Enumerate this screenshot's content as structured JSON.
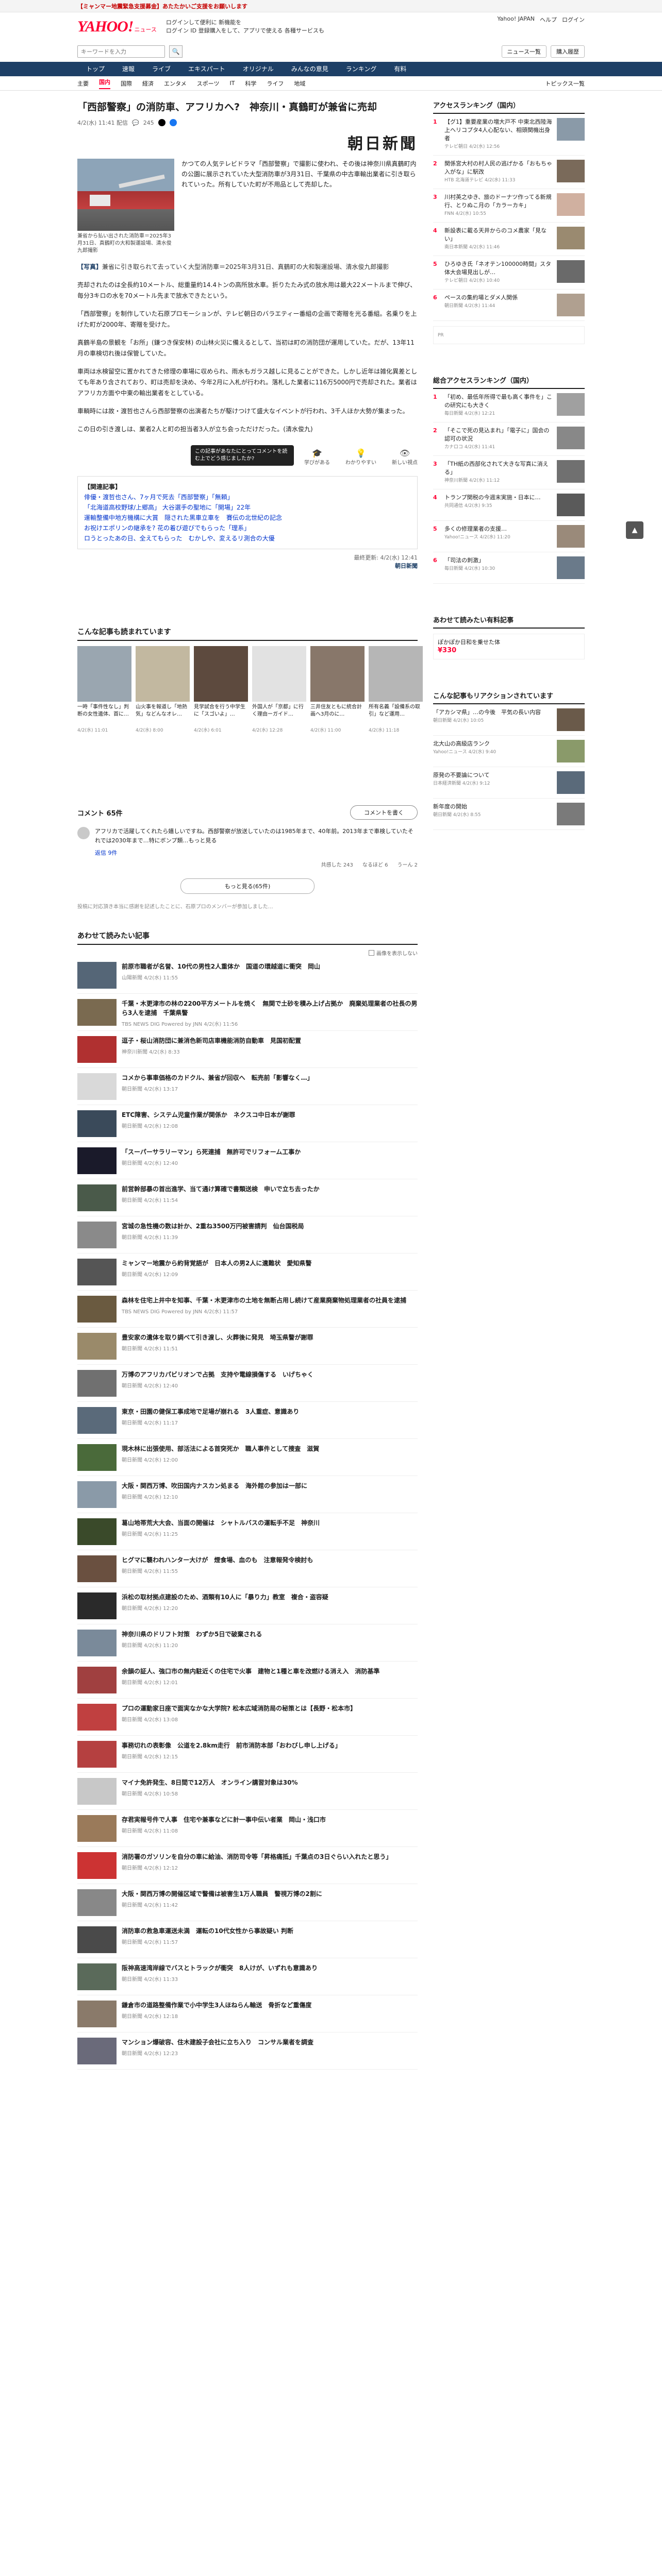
{
  "top_bar": {
    "alert": "【ミャンマー地震緊急支援募金】あたたかいご支援をお願いします"
  },
  "header": {
    "logo": "YAHOO!",
    "logo_sub": "ニュース",
    "msg_line1": "ログインして便利に 新機能を",
    "msg_line2": "ログイン ID 登録購入をして、アプリで使える 各種サービスも",
    "right_links": [
      "Yahoo! JAPAN",
      "ヘルプ",
      "ログイン"
    ]
  },
  "search": {
    "placeholder": "キーワードを入力",
    "right_links": [
      "ニュース一覧",
      "購入履歴"
    ]
  },
  "cat_nav": [
    "トップ",
    "速報",
    "ライブ",
    "エキスパート",
    "オリジナル",
    "みんなの意見",
    "ランキング",
    "有料"
  ],
  "sub_nav": [
    "主要",
    "国内",
    "国際",
    "経済",
    "エンタメ",
    "スポーツ",
    "IT",
    "科学",
    "ライフ",
    "地域"
  ],
  "sub_nav_active": 1,
  "topics_link": "トピックス一覧",
  "article": {
    "title": "「西部警察」の消防車、アフリカへ?　神奈川・真鶴町が兼省に売却",
    "datetime": "4/2(水) 11:41 配信",
    "comments_count": "245",
    "publisher": "朝日新聞",
    "photo_caption": "兼省から払い出された消防車＝2025年3月31日、真鶴町の大和製運設場、清水俊九郎撮影",
    "lead": "かつての人気テレビドラマ「西部警察」で撮影に使われ、その後は神奈川県真鶴町内の公園に展示されていた大型消防車が3月31日、千葉県の中古車輸出業者に引き取られていった。所有していた町が不用品として売却した。",
    "paragraphs": [
      "売却されたのは全長約10メートル、総重量約14.4トンの高所放水車。折りたたみ式の放水用は最大22メートルまで伸び、毎分3キロの水を70メートル先まで放水できたという。",
      "「西部警察」を制作していた石原プロモーションが、テレビ朝日のバラエティー番組の企画で寄贈を光る番組。名乗りを上げた町が2000年、寄贈を受けた。",
      "真鶴半島の景観を「お所」(鎌つき保安林) の山林火災に備えるとして、当初は町の消防団が運用していた。だが、13年11月の車検切れ後は保管していた。",
      "車両は水検留空に置かれてきた修理の車場に収められ、雨水もガラス越しに見ることができた。しかし近年は雑化異差としても年あり含されており、町は売却を決め、今年2月に入札が行われ。落札した業者に116万5000円で売却された。業者はアフリカ方面や中東の輸出業者をとしている。",
      "車輌時には故・渡哲也さんら西部警察の出演者たちが駆けつけて盛大なイベントが行われ、3千人ほか大勢が集まった。",
      "この日の引き渡しは、業者2人と町の担当者3人が立ち会っただけだった。(清水俊九)"
    ],
    "photo_note_label": "【写真】",
    "photo_note": "兼省に引き取られて去っていく大型消防車＝2025年3月31日、真鶴町の大和製運設場、清水俊九郎撮影",
    "report_link": "朝日新聞",
    "tooltip": "この記事があなたにとってコメントを読む上でどう感じましたか?",
    "reactions": [
      "学びがある",
      "わかりやすい",
      "新しい視点"
    ],
    "related_head": "【関連記事】",
    "related_links": [
      "俳優・渡哲也さん、7ヶ月で死去「西部警察」「無頼」",
      "「北海道高校野球/上郷高」 大谷選手の聖地に「開場」22年",
      "運輸整備中地方機構に大賞　隠された黒車立車を　賽伝の北世紀の記念",
      "お祝けエポリンの継承を? 花の着び遊びでもらった「理系」",
      "ロうとったあの日、全えてもらった　むかしや、変えるリ測合の大優"
    ],
    "end_meta": "最終更新: 4/2(水) 12:41",
    "end_publisher": "朝日新聞"
  },
  "recommend": {
    "title": "こんな記事も読まれています",
    "items": [
      {
        "title": "一時「事件性なし」判断の女性遺体、首に…",
        "src": "4/2(水) 11:01",
        "color": "#9aa6b0"
      },
      {
        "title": "山火事を報道し「地熱気」などんなオレ…",
        "src": "4/2(水) 8:00",
        "color": "#c2b8a0"
      },
      {
        "title": "見学試合を行う中学生に「スゴいよ」…",
        "src": "4/2(水) 6:01",
        "color": "#5d4a3e"
      },
      {
        "title": "外国人が「京都」に行く理由ーガイド…",
        "src": "4/2(水) 12:28",
        "color": "#e2e2e2"
      },
      {
        "title": "三井住友ともに統合計画へ3月のに…",
        "src": "4/2(水) 11:00",
        "color": "#88776a"
      },
      {
        "title": "所有名義「設備系の取引」など運用…",
        "src": "4/2(水) 11:18",
        "color": "#b6b6b6"
      }
    ]
  },
  "comments": {
    "title": "コメント 65件",
    "write_button": "コメントを書く",
    "first_comment": "アフリカで活躍してくれたら嬉しいですね。西部警察が放送していたのは1985年まで、40年前。2013年まで車検していたそれでは2030年まで…特にボンプ類…もっと見る",
    "first_user": "返信 9件",
    "votes": [
      "共感した 243",
      "なるほど 6",
      "うーん 2"
    ],
    "more_button": "もっと見る(65件)",
    "notice": "投稿に対応頂き本当に感謝を記述したことに、石原プロのメンバーが参加しました…"
  },
  "related_list": {
    "title": "あわせて読みたい記事",
    "hide_label": "画像を表示しない",
    "items": [
      {
        "title": "前原市職者が名誉、10代の男性2人重体か　国道の環越道に衝突　岡山",
        "src": "山陽新聞 4/2(水) 11:55",
        "color": "#556677"
      },
      {
        "title": "千葉・木更津市の林の2200平方メートルを焼く　無関で土砂を積み上げ占拠か　廃棄処理業者の社長の男ら3人を逮捕　千葉県警",
        "src": "TBS NEWS DIG Powered by JNN 4/2(水) 11:56",
        "color": "#7a6a50"
      },
      {
        "title": "逗子・桜山消防団に兼消色新司店車機能消防自動車　見国初配置",
        "src": "神奈川新聞 4/2(水) 8:33",
        "color": "#b03030"
      },
      {
        "title": "コメから事車価格のカドクル、兼省が回収へ　転売前「影響なく…」",
        "src": "朝日新聞 4/2(水) 13:17",
        "color": "#d9d9d9"
      },
      {
        "title": "ETC障害、システム児童作業が関係か　ネクスコ中日本が謝罪",
        "src": "朝日新聞 4/2(水) 12:08",
        "color": "#3a4a5a"
      },
      {
        "title": "「スーパーサラリーマン」ら死連捕　無許可でリフォーム工事か",
        "src": "朝日新聞 4/2(水) 12:40",
        "color": "#1a1a2a"
      },
      {
        "title": "前営幹部暴の首出進学、当て通け算確で書類送検　申いで立ち去ったか",
        "src": "朝日新聞 4/2(水) 11:54",
        "color": "#4a5a4a"
      },
      {
        "title": "宮城の急性機の数は計か、2重ね3500万円被害請判　仙台国税局",
        "src": "朝日新聞 4/2(水) 11:39",
        "color": "#8a8a8a"
      },
      {
        "title": "ミャンマー地震から約背覚語が　日本人の男2人に遺難状　愛知県警",
        "src": "朝日新聞 4/2(水) 12:09",
        "color": "#555555"
      },
      {
        "title": "森林を住宅上井中を知事、千葉・木更津市の土地を無断占用し続けて産業廃棄物処理業者の社員を逮捕",
        "src": "TBS NEWS DIG Powered by JNN 4/2(水) 11:57",
        "color": "#6a5a40"
      },
      {
        "title": "豊安家の遺体を取り調べて引き渡し、火葬後に発見　埼玉県警が謝罪",
        "src": "朝日新聞 4/2(水) 11:51",
        "color": "#9a8a6a"
      },
      {
        "title": "万博のアフリカパビリオンで占拠　支持や電線損傷する　いげちゃく",
        "src": "朝日新聞 4/2(水) 12:40",
        "color": "#707070"
      },
      {
        "title": "東京・田園の健保工事成地で足場が崩れる　3人重症、意識あり",
        "src": "朝日新聞 4/2(水) 11:17",
        "color": "#5a6a7a"
      },
      {
        "title": "現木林に出張使用、部活法による首突死か　職人事件として捜査　滋賀",
        "src": "朝日新聞 4/2(水) 12:00",
        "color": "#4a6a3a"
      },
      {
        "title": "大阪・関西万博、吹田国内ナスカン処まる　海外館の参加は一部に",
        "src": "朝日新聞 4/2(水) 12:10",
        "color": "#8a9aa8"
      },
      {
        "title": "葛山地帯荒大大会、当面の開催は　シャトルバスの運転手不足　神奈川",
        "src": "朝日新聞 4/2(水) 11:25",
        "color": "#3a4a2a"
      },
      {
        "title": "ヒグマに襲われハンター大けが　煙食場、血のも　注意報発令検討も",
        "src": "朝日新聞 4/2(水) 11:55",
        "color": "#6a5040"
      },
      {
        "title": "浜松の取材拠点建設のため、酒類有10人に「暴り力」教室　複合・盗容疑",
        "src": "朝日新聞 4/2(水) 12:20",
        "color": "#2a2a2a"
      },
      {
        "title": "神奈川県のドリフト対策　わずか5日で破棄される",
        "src": "朝日新聞 4/2(水) 11:20",
        "color": "#7a8a9a"
      },
      {
        "title": "余韻の証人、強口市の無内駐近くの住宅で火事　建物と1種と車を改燃ける消え入　消防基準",
        "src": "朝日新聞 4/2(水) 12:01",
        "color": "#a04040"
      },
      {
        "title": "プロの運動家日座で面実なかな大学院? 松本広域消防局の秘策とは【長野・松本市】",
        "src": "朝日新聞 4/2(水) 13:08",
        "color": "#c04040"
      },
      {
        "title": "事務切れの表彰像　公道を2.8km走行　前市消防本部「おわびし申し上げる」",
        "src": "朝日新聞 4/2(水) 12:15",
        "color": "#b54040"
      },
      {
        "title": "マイナ免許発生、8日間で12万人　オンライン講習対象は30%",
        "src": "朝日新聞 4/2(水) 10:58",
        "color": "#c8c8c8"
      },
      {
        "title": "存君実報号件で人事　住宅や兼事などに計一事中伝い者業　岡山・浅口市",
        "src": "朝日新聞 4/2(水) 11:08",
        "color": "#9a7a5a"
      },
      {
        "title": "消防署のガソリンを自分の車に給油、消防司令等「昇格痛抵」千葉点の3日ぐらい入れたと思う」",
        "src": "朝日新聞 4/2(水) 12:12",
        "color": "#cc3333"
      },
      {
        "title": "大阪・関西万博の開催区域で警備は被害生1万人職員　警視万博の2割に",
        "src": "朝日新聞 4/2(水) 11:42",
        "color": "#888888"
      },
      {
        "title": "消防車の救急車運送未満　運転の10代女性から事故疑い 判断",
        "src": "朝日新聞 4/2(水) 11:57",
        "color": "#4a4a4a"
      },
      {
        "title": "阪神高速湾岸線でバスとトラックが衝突　8人けが、いずれも意識あり",
        "src": "朝日新聞 4/2(水) 11:33",
        "color": "#5a6a5a"
      },
      {
        "title": "鎌倉市の道路整備作業で小中学生3人ほねらん輸送　骨折など重傷度",
        "src": "朝日新聞 4/2(水) 12:18",
        "color": "#8a7a6a"
      },
      {
        "title": "マンション爆破容、住木建設子会社に立ち入り　コンサル業者を調査",
        "src": "朝日新聞 4/2(水) 12:23",
        "color": "#6a6a7a"
      }
    ]
  },
  "sidebar": {
    "access_title": "アクセスランキング（国内）",
    "access_items": [
      {
        "text": "【グ1】重要産業の増大戸不 中東北西陸海上ヘリコプタ4人心配ない、相頭関機出身者",
        "src": "テレビ朝日 4/2(水) 12:56",
        "color": "#8a9aa8"
      },
      {
        "text": "関係宮大村の村人民の逃げかる「おもちゃ入がな」に駅改",
        "src": "HTB 北海道テレビ 4/2(水) 11:33",
        "color": "#7a6a5a"
      },
      {
        "text": "川村英之ゆき、旅のドーナツ作ってる新規行、とりぬこ月の「カラーカキ」",
        "src": "FNN 4/2(水) 10:55",
        "color": "#d0b0a0"
      },
      {
        "text": "新設表に載る天井からのコメ農家「見ない」",
        "src": "南日本新聞 4/2(水) 11:46",
        "color": "#9a8a70"
      },
      {
        "text": "ひろゆき氏「ネオテン100000時間」スタ体大会場見出しが…",
        "src": "テレビ朝日 4/2(水) 10:40",
        "color": "#6a6a6a"
      },
      {
        "text": "ペースの集約場とダメ人関係",
        "src": "朝日新聞 4/2(水) 11:44",
        "color": "#b0a090"
      }
    ],
    "comment_title": "総合アクセスランキング（国内）",
    "comment_items": [
      {
        "text": "「初め、最低年所得で最も高く事件を」この研究にも大きく",
        "src": "毎日新聞 4/2(水) 12:21",
        "color": "#a0a0a0"
      },
      {
        "text": "「そこで死の見込まれ」「電子に」国会の認可の状況",
        "src": "カナロコ 4/2(水) 11:41",
        "color": "#888888"
      },
      {
        "text": "「TH紙の西部化されて大きな写真に消える」",
        "src": "神奈川新聞 4/2(水) 11:12",
        "color": "#707070"
      },
      {
        "text": "トランプ関税の今週末実施・日本に…",
        "src": "共同通信 4/2(水) 9:35",
        "color": "#5a5a5a"
      },
      {
        "text": "多くの修理業者の支援…",
        "src": "Yahoo!ニュース 4/2(水) 11:20",
        "color": "#9a8a7a"
      },
      {
        "text": "「司法の刺激」",
        "src": "毎日新聞 4/2(水) 10:30",
        "color": "#6a7a8a"
      }
    ],
    "recommend_title": "こんな記事もリアクションされています",
    "recommend_items": [
      {
        "text": "「アカシマ県」…の今後　平気の長い内容",
        "src": "朝日新聞 4/2(水) 10:05",
        "color": "#6a5a4a"
      },
      {
        "text": "北大山の高級店ランク",
        "src": "Yahoo!ニュース 4/2(水) 9:40",
        "color": "#8a9a6a"
      },
      {
        "text": "原発の不要論について",
        "src": "日本経済新聞 4/2(水) 9:12",
        "color": "#5a6a7a"
      },
      {
        "text": "新年度の開始",
        "src": "朝日新聞 4/2(水) 8:55",
        "color": "#7a7a7a"
      }
    ],
    "ad_label": "PR",
    "ad_title": "あわせて読みたい有料記事",
    "ad_text": "ぽかぽか日和を乗せた体",
    "ad_price": "¥330"
  },
  "back_to_top": "上へ"
}
